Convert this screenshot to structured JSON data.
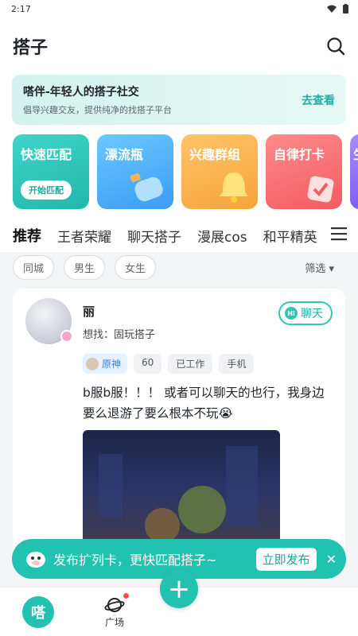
{
  "status": {
    "time": "2:17"
  },
  "appbar": {
    "title": "搭子"
  },
  "banner": {
    "title": "嗒伴-年轻人的搭子社交",
    "subtitle": "倡导兴趣交友，提供纯净的找搭子平台",
    "link": "去查看"
  },
  "cards": [
    {
      "title": "快速匹配",
      "button": "开始匹配"
    },
    {
      "title": "漂流瓶"
    },
    {
      "title": "兴趣群组"
    },
    {
      "title": "自律打卡"
    },
    {
      "title": "生"
    }
  ],
  "tabs": [
    "推荐",
    "王者荣耀",
    "聊天搭子",
    "漫展cos",
    "和平精英"
  ],
  "filters": {
    "chips": [
      "同城",
      "男生",
      "女生"
    ],
    "sort": "筛选 ▾"
  },
  "post": {
    "name": "丽",
    "find": "想找：固玩搭子",
    "chat_label": "聊天",
    "chat_hi": "Hi",
    "tags": [
      "原神",
      "60",
      "已工作",
      "手机"
    ],
    "text": "b服b服！！！ 或者可以聊天的也行，我身边要么退游了要么根本不玩😭"
  },
  "toast": {
    "text": "发布扩列卡，更快匹配搭子~",
    "button": "立即发布",
    "close": "✕"
  },
  "nav": {
    "home": "嗒",
    "square": "广场",
    "plus": "+"
  },
  "colors": {
    "accent": "#23c1b0"
  }
}
